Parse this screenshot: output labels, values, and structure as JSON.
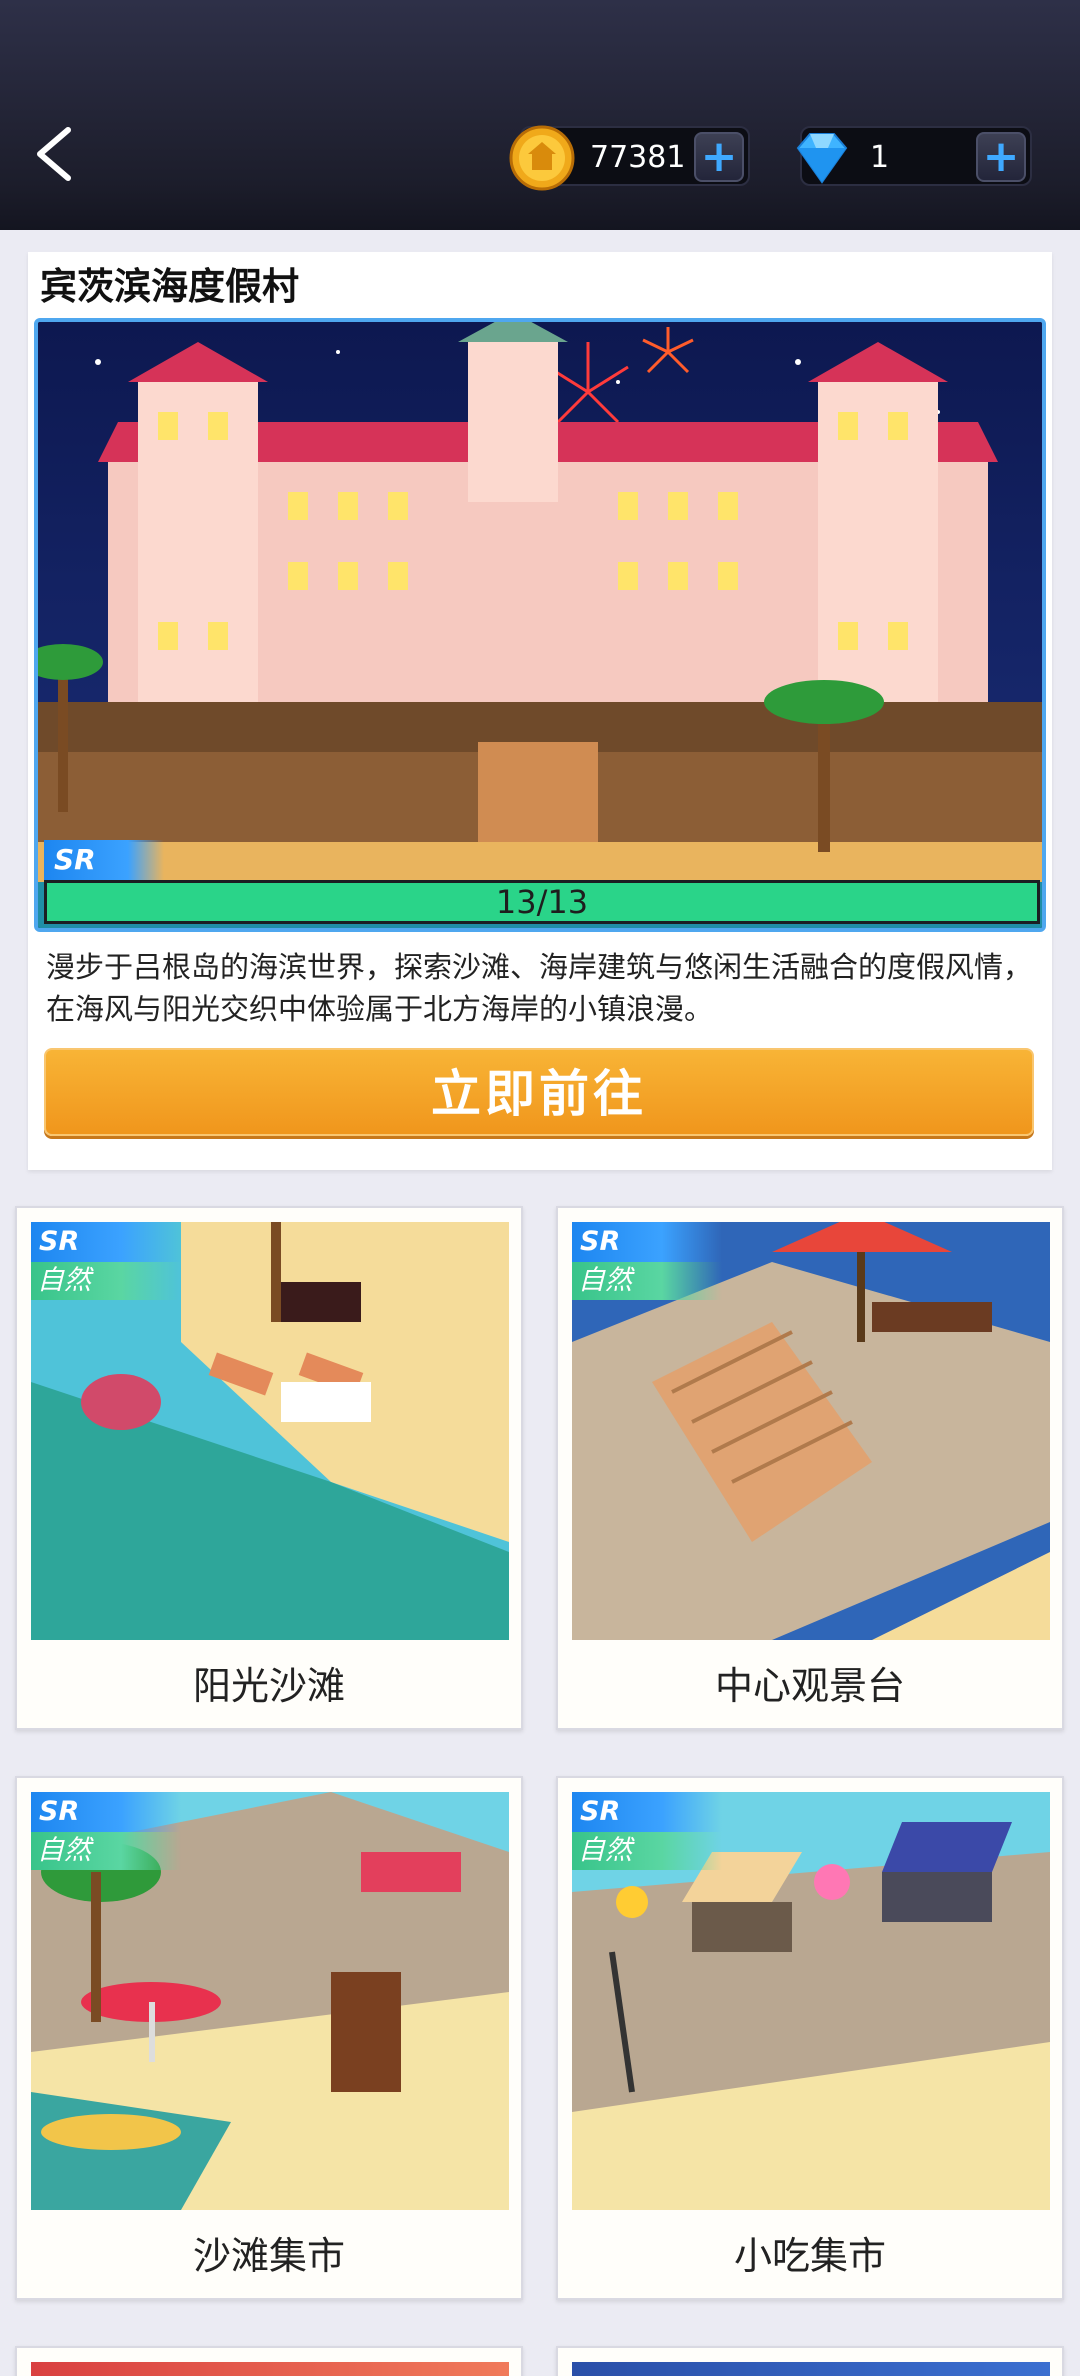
{
  "header": {
    "coins": "77381",
    "gems": "1",
    "plus_label": "+"
  },
  "feature": {
    "title": "宾茨滨海度假村",
    "rarity": "SR",
    "progress_text": "13/13",
    "progress_fraction": 1.0,
    "description": "漫步于吕根岛的海滨世界，探索沙滩、海岸建筑与悠闲生活融合的度假风情，在海风与阳光交织中体验属于北方海岸的小镇浪漫。",
    "button_label": "立即前往"
  },
  "cards": [
    {
      "rarity": "SR",
      "category": "自然",
      "label": "阳光沙滩"
    },
    {
      "rarity": "SR",
      "category": "自然",
      "label": "中心观景台"
    },
    {
      "rarity": "SR",
      "category": "自然",
      "label": "沙滩集市"
    },
    {
      "rarity": "SR",
      "category": "自然",
      "label": "小吃集市"
    }
  ],
  "colors": {
    "accent_blue": "#4fa7ef",
    "progress_green": "#2ad489",
    "button_orange": "#f4a52a",
    "nature_green": "#38c48a"
  }
}
